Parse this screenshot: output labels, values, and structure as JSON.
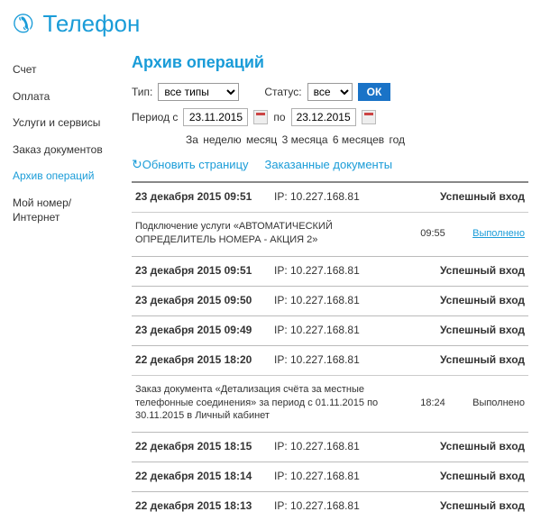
{
  "header": {
    "title": "Телефон"
  },
  "sidebar": {
    "items": [
      {
        "label": "Счет"
      },
      {
        "label": "Оплата"
      },
      {
        "label": "Услуги и сервисы"
      },
      {
        "label": "Заказ документов"
      },
      {
        "label": "Архив операций"
      },
      {
        "label": "Мой номер/Интернет"
      }
    ]
  },
  "section": {
    "title": "Архив операций"
  },
  "filters": {
    "type_label": "Тип:",
    "type_value": "все типы",
    "status_label": "Статус:",
    "status_value": "все",
    "ok": "ОК",
    "period_label": "Период с",
    "date_from": "23.11.2015",
    "to_label": "по",
    "date_to": "23.12.2015",
    "quick": {
      "prefix": "За",
      "week": "неделю",
      "month": "месяц",
      "m3": "3 месяца",
      "m6": "6 месяцев",
      "year": "год"
    }
  },
  "actions": {
    "refresh": "Обновить страницу",
    "ordered_docs": "Заказанные документы"
  },
  "rows": [
    {
      "kind": "login",
      "date": "23 декабря 2015 09:51",
      "ip": "IP: 10.227.168.81",
      "status": "Успешный вход"
    },
    {
      "kind": "detail",
      "text": "Подключение услуги «АВТОМАТИЧЕСКИЙ ОПРЕДЕЛИТЕЛЬ НОМЕРА - АКЦИЯ 2»",
      "time": "09:55",
      "status": "Выполнено",
      "link": true
    },
    {
      "kind": "login",
      "date": "23 декабря 2015 09:51",
      "ip": "IP: 10.227.168.81",
      "status": "Успешный вход"
    },
    {
      "kind": "login",
      "date": "23 декабря 2015 09:50",
      "ip": "IP: 10.227.168.81",
      "status": "Успешный вход"
    },
    {
      "kind": "login",
      "date": "23 декабря 2015 09:49",
      "ip": "IP: 10.227.168.81",
      "status": "Успешный вход"
    },
    {
      "kind": "login",
      "date": "22 декабря 2015 18:20",
      "ip": "IP: 10.227.168.81",
      "status": "Успешный вход"
    },
    {
      "kind": "detail",
      "text": "Заказ документа «Детализация счёта за местные телефонные соединения» за период с 01.11.2015 по 30.11.2015 в Личный кабинет",
      "time": "18:24",
      "status": "Выполнено",
      "link": false
    },
    {
      "kind": "login",
      "date": "22 декабря 2015 18:15",
      "ip": "IP: 10.227.168.81",
      "status": "Успешный вход"
    },
    {
      "kind": "login",
      "date": "22 декабря 2015 18:14",
      "ip": "IP: 10.227.168.81",
      "status": "Успешный вход"
    },
    {
      "kind": "login",
      "date": "22 декабря 2015 18:13",
      "ip": "IP: 10.227.168.81",
      "status": "Успешный вход"
    }
  ]
}
